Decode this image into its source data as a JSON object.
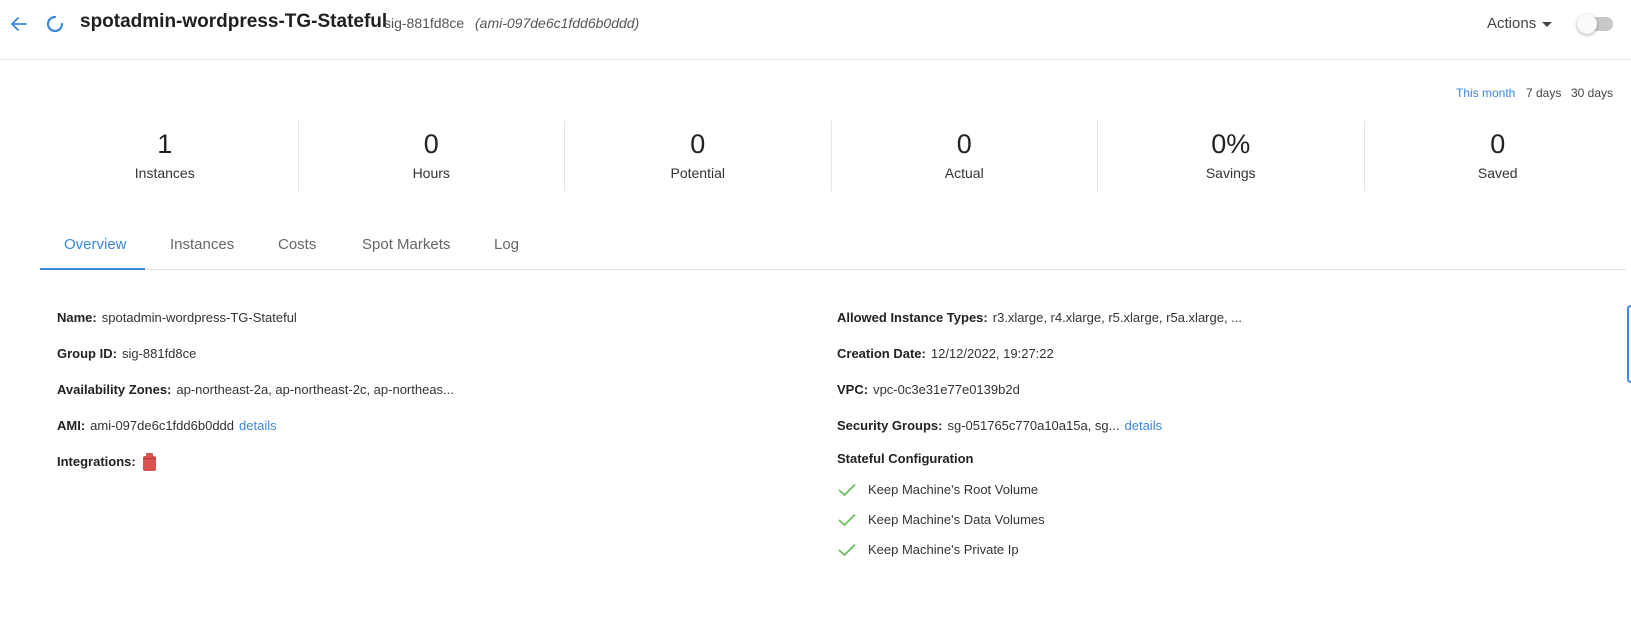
{
  "header": {
    "title": "spotadmin-wordpress-TG-Stateful",
    "group_id": "sig-881fd8ce",
    "ami": "(ami-097de6c1fdd6b0ddd)",
    "actions_label": "Actions"
  },
  "range": {
    "options": [
      "This month",
      "7 days",
      "30 days"
    ],
    "selected": "This month"
  },
  "stats": [
    {
      "value": "1",
      "label": "Instances"
    },
    {
      "value": "0",
      "label": "Hours"
    },
    {
      "value": "0",
      "label": "Potential"
    },
    {
      "value": "0",
      "label": "Actual"
    },
    {
      "value": "0%",
      "label": "Savings"
    },
    {
      "value": "0",
      "label": "Saved"
    }
  ],
  "tabs": [
    "Overview",
    "Instances",
    "Costs",
    "Spot Markets",
    "Log"
  ],
  "active_tab": "Overview",
  "overview": {
    "left": {
      "name": {
        "label": "Name:",
        "value": "spotadmin-wordpress-TG-Stateful"
      },
      "group_id": {
        "label": "Group ID:",
        "value": "sig-881fd8ce"
      },
      "availability_zones": {
        "label": "Availability Zones:",
        "value": "ap-northeast-2a, ap-northeast-2c, ap-northeas..."
      },
      "ami": {
        "label": "AMI:",
        "value": "ami-097de6c1fdd6b0ddd",
        "link": "details"
      },
      "integrations": {
        "label": "Integrations:",
        "icon": "integration-icon"
      }
    },
    "right": {
      "allowed_instance_types": {
        "label": "Allowed Instance Types:",
        "value": "r3.xlarge, r4.xlarge, r5.xlarge, r5a.xlarge, ..."
      },
      "creation_date": {
        "label": "Creation Date:",
        "value": "12/12/2022, 19:27:22"
      },
      "vpc": {
        "label": "VPC:",
        "value": "vpc-0c3e31e77e0139b2d"
      },
      "security_groups": {
        "label": "Security Groups:",
        "value": "sg-051765c770a10a15a, sg...",
        "link": "details"
      },
      "stateful_configuration": {
        "title": "Stateful Configuration",
        "items": [
          "Keep Machine's Root Volume",
          "Keep Machine's Data Volumes",
          "Keep Machine's Private Ip"
        ]
      }
    }
  },
  "colors": {
    "accent": "#3a87e0",
    "check": "#6abf5e",
    "integration": "#d9534f"
  }
}
